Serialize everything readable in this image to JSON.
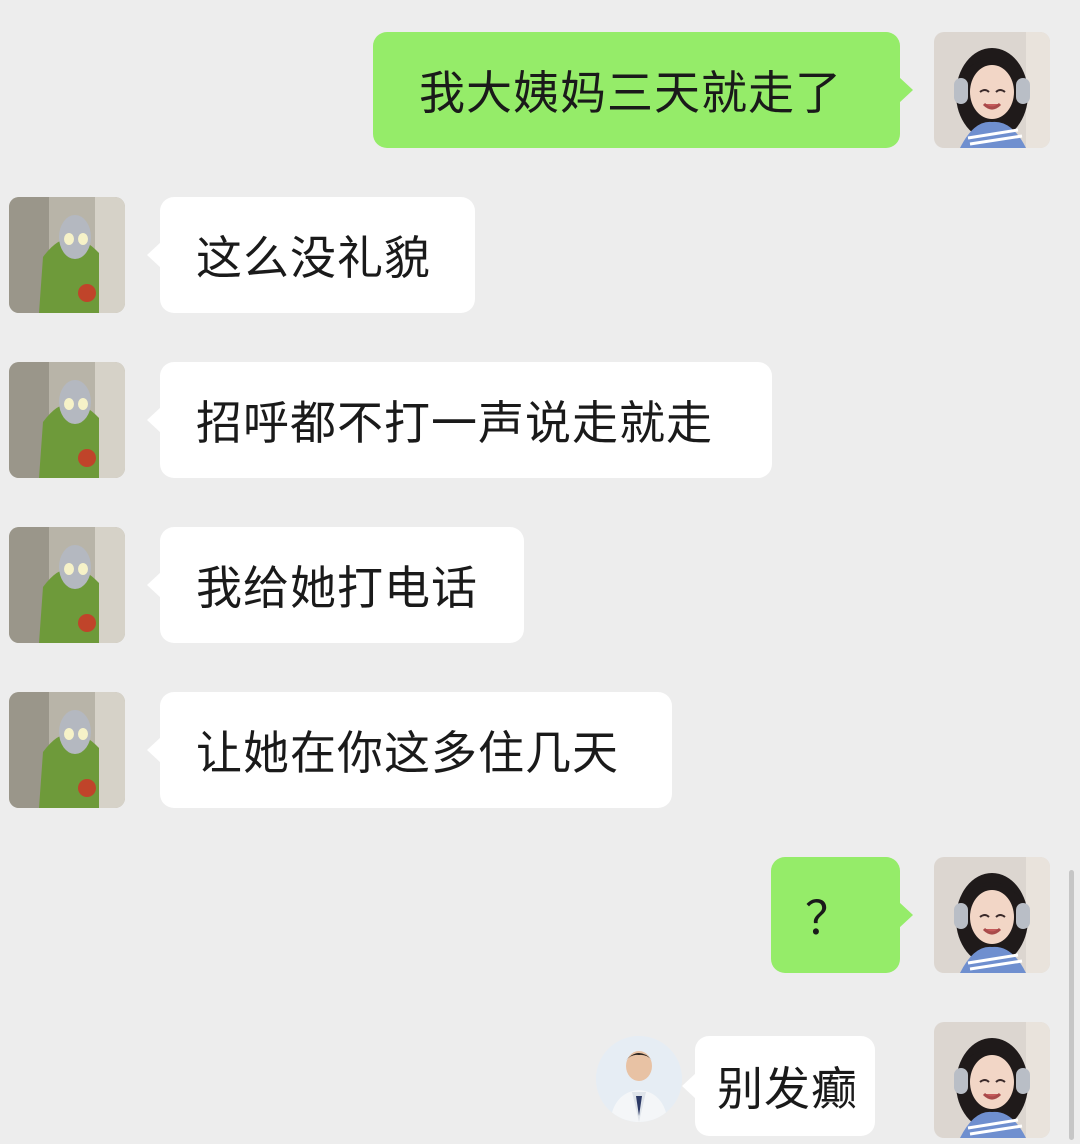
{
  "messages": [
    {
      "side": "right",
      "text": "我大姨妈三天就走了",
      "avatar": "user-avatar"
    },
    {
      "side": "left",
      "text": "这么没礼貌",
      "avatar": "friend-avatar"
    },
    {
      "side": "left",
      "text": "招呼都不打一声说走就走",
      "avatar": "friend-avatar"
    },
    {
      "side": "left",
      "text": "我给她打电话",
      "avatar": "friend-avatar"
    },
    {
      "side": "left",
      "text": "让她在你这多住几天",
      "avatar": "friend-avatar"
    },
    {
      "side": "right",
      "text": "？",
      "avatar": "user-avatar"
    },
    {
      "side": "right",
      "text": "别发癫",
      "avatar": "user-avatar",
      "sticker": "doctor-portrait-sticker"
    }
  ],
  "colors": {
    "background": "#ededed",
    "incoming_bubble": "#ffffff",
    "outgoing_bubble": "#95ec69",
    "text": "#1a1a1a"
  }
}
